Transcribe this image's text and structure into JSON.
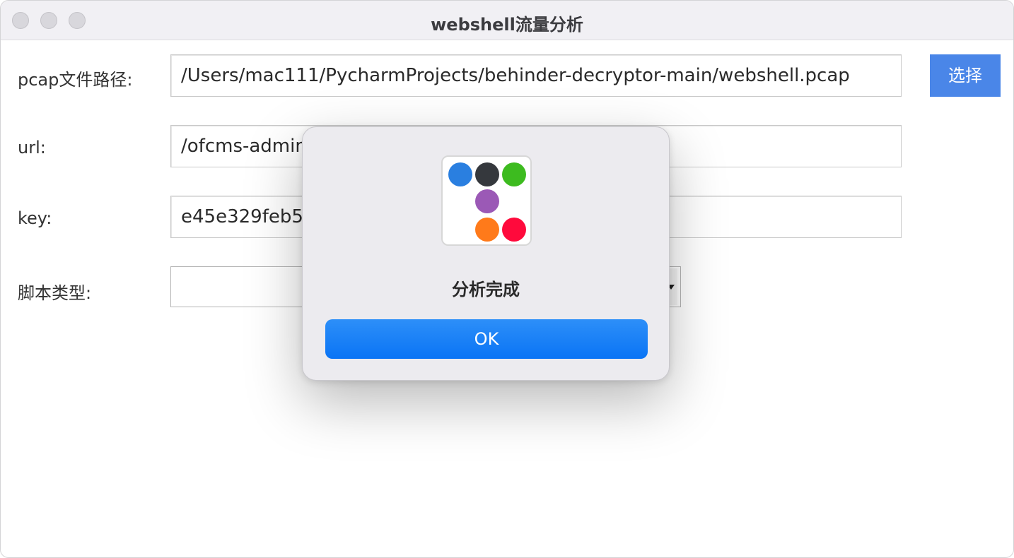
{
  "window": {
    "title": "webshell流量分析"
  },
  "form": {
    "pcap_label": "pcap文件路径:",
    "pcap_value": "/Users/mac111/PycharmProjects/behinder-decryptor-main/webshell.pcap",
    "choose_button": "选择",
    "url_label": "url:",
    "url_value": "/ofcms-admin/",
    "key_label": "key:",
    "key_value": "e45e329feb5c",
    "script_type_label": "脚本类型:"
  },
  "dialog": {
    "message": "分析完成",
    "ok_button": "OK",
    "icon_colors": [
      "#2a7fe0",
      "#35383d",
      "#3dbb1f",
      "#9b59b6",
      "#ff7a1a",
      "#ff0a3c"
    ]
  }
}
